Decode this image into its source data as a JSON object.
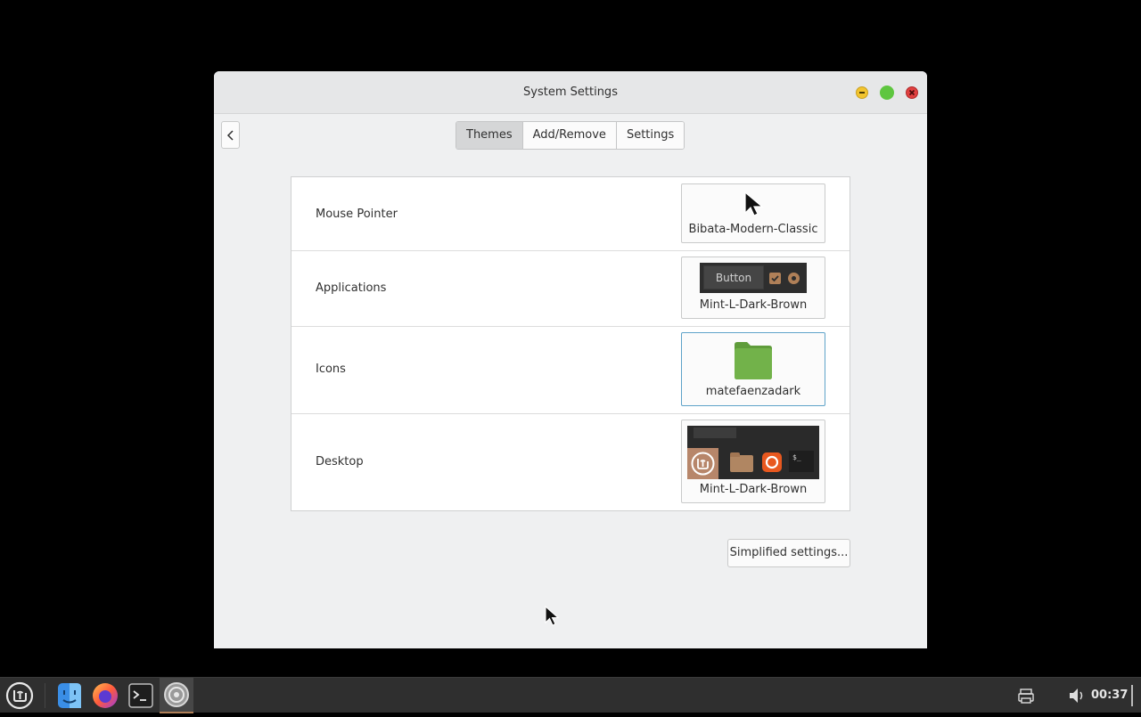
{
  "window": {
    "title": "System Settings",
    "controls": [
      "minimize-icon",
      "maximize-icon",
      "close-icon"
    ]
  },
  "nav": {
    "back_icon": "chevron-left-icon",
    "tabs": [
      {
        "label": "Themes",
        "active": true
      },
      {
        "label": "Add/Remove",
        "active": false
      },
      {
        "label": "Settings",
        "active": false
      }
    ]
  },
  "themes": {
    "rows": [
      {
        "label": "Mouse Pointer",
        "value": "Bibata-Modern-Classic",
        "preview": "pointer-preview-icon"
      },
      {
        "label": "Applications",
        "value": "Mint-L-Dark-Brown",
        "preview": "widget-preview",
        "preview_button": "Button"
      },
      {
        "label": "Icons",
        "value": "matefaenzadark",
        "preview": "folder-preview-icon"
      },
      {
        "label": "Desktop",
        "value": "Mint-L-Dark-Brown",
        "preview": "desktop-preview",
        "preview_term": "$_"
      }
    ]
  },
  "simplified_button": "Simplified settings...",
  "taskbar": {
    "apps": [
      "mint-menu-icon",
      "file-manager-icon",
      "firefox-icon",
      "terminal-icon",
      "system-settings-icon"
    ],
    "tray": [
      "printer-icon",
      "volume-icon"
    ],
    "clock": "00:37"
  },
  "colors": {
    "accent": "#b08058",
    "folder_green": "#6cab44",
    "focus_border": "#5ea3c9"
  }
}
